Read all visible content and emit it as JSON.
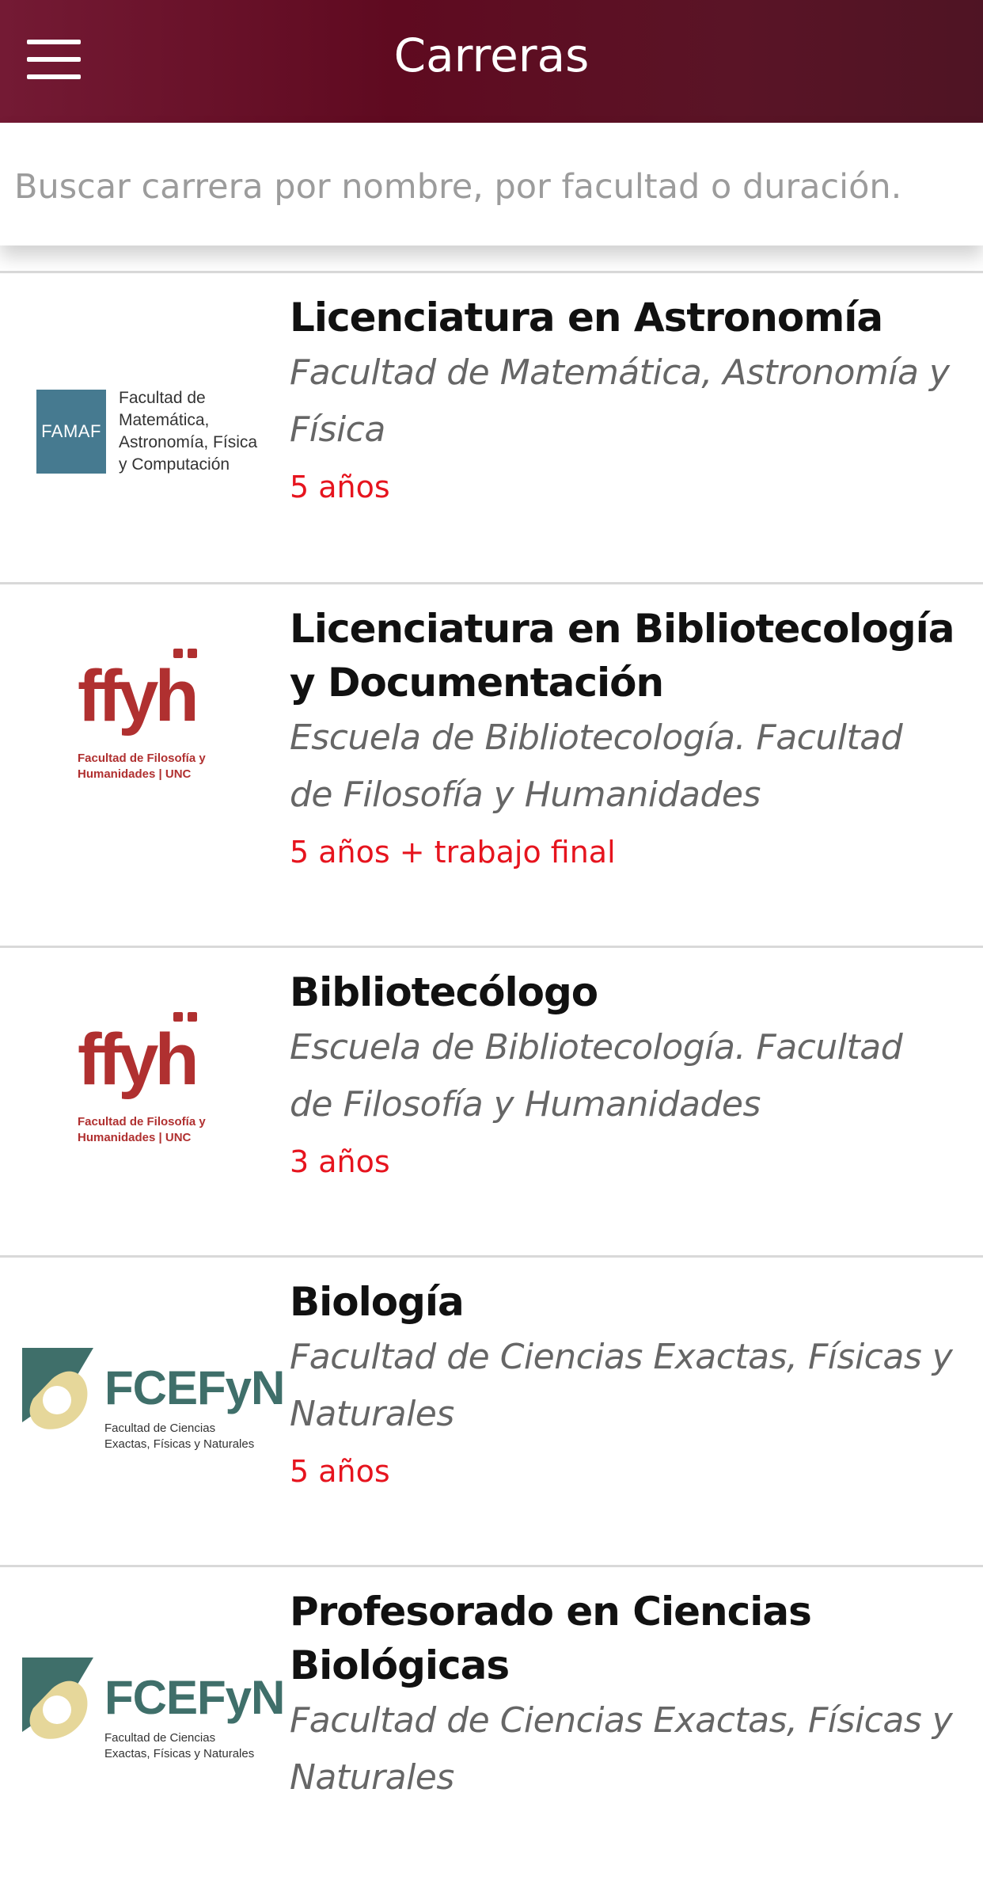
{
  "header": {
    "title": "Carreras",
    "menu_icon": "hamburger-menu-icon"
  },
  "search": {
    "placeholder": "Buscar carrera por nombre, por facultad o duración.",
    "value": ""
  },
  "colors": {
    "header": "#5f0a20",
    "duration": "#e6141e",
    "ffyh_logo": "#b03030",
    "famaf_logo": "#467a90",
    "fcefyn_logo": "#3f6f6a"
  },
  "careers": [
    {
      "name": "Licenciatura en Astronomía",
      "faculty": "Facultad de Matemática, Astronomía y Física",
      "duration": "5 años",
      "logo": {
        "badge": "FAMAF",
        "text": "Facultad de Matemática, Astronomía, Física y Computación"
      }
    },
    {
      "name": "Licenciatura en Bibliotecología y Documentación",
      "faculty": "Escuela de Bibliotecología. Facultad de Filosofía y Humanidades",
      "duration": "5 años + trabajo final",
      "logo": {
        "mark": "ffyh",
        "text": "Facultad de Filosofía y Humanidades | UNC"
      }
    },
    {
      "name": "Bibliotecólogo",
      "faculty": "Escuela de Bibliotecología. Facultad de Filosofía y Humanidades",
      "duration": "3 años",
      "logo": {
        "mark": "ffyh",
        "text": "Facultad de Filosofía y Humanidades | UNC"
      }
    },
    {
      "name": "Biología",
      "faculty": "Facultad de Ciencias Exactas, Físicas y Naturales",
      "duration": "5 años",
      "logo": {
        "mark": "FCEFyN",
        "text": "Facultad de Ciencias Exactas, Físicas y Naturales"
      }
    },
    {
      "name": "Profesorado en Ciencias Biológicas",
      "faculty": "Facultad de Ciencias Exactas, Físicas y Naturales",
      "duration": "",
      "logo": {
        "mark": "FCEFyN",
        "text": "Facultad de Ciencias Exactas, Físicas y Naturales"
      }
    }
  ]
}
